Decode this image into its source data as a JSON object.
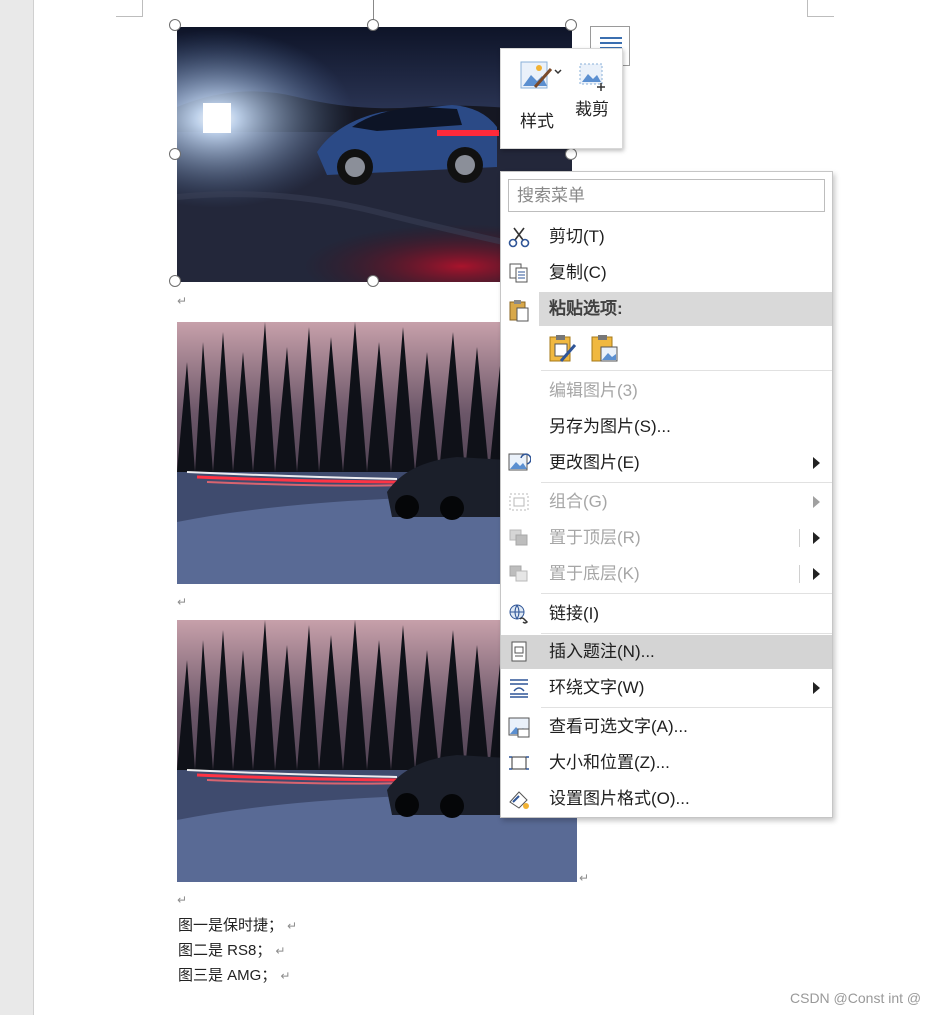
{
  "document": {
    "captions": [
      "图一是保时捷；",
      "图二是 RS8；",
      "图三是 AMG；"
    ],
    "paragraph_mark": "↵"
  },
  "mini_toolbar": {
    "style_label": "样式",
    "crop_label": "裁剪"
  },
  "context_menu": {
    "search_placeholder": "搜索菜单",
    "items": [
      {
        "label": "剪切(T)",
        "icon": "scissors-icon"
      },
      {
        "label": "复制(C)",
        "icon": "copy-icon"
      },
      {
        "label": "粘贴选项:",
        "icon": "paste-icon"
      },
      {
        "label": "编辑图片(3)",
        "icon": ""
      },
      {
        "label": "另存为图片(S)...",
        "icon": ""
      },
      {
        "label": "更改图片(E)",
        "icon": "change-picture-icon"
      },
      {
        "label": "组合(G)",
        "icon": "group-icon"
      },
      {
        "label": "置于顶层(R)",
        "icon": "bring-to-front-icon"
      },
      {
        "label": "置于底层(K)",
        "icon": "send-to-back-icon"
      },
      {
        "label": "链接(I)",
        "icon": "link-icon"
      },
      {
        "label": "插入题注(N)...",
        "icon": "insert-caption-icon"
      },
      {
        "label": "环绕文字(W)",
        "icon": "wrap-text-icon"
      },
      {
        "label": "查看可选文字(A)...",
        "icon": "alt-text-icon"
      },
      {
        "label": "大小和位置(Z)...",
        "icon": "size-position-icon"
      },
      {
        "label": "设置图片格式(O)...",
        "icon": "format-picture-icon"
      }
    ]
  },
  "watermark": "CSDN @Const int @",
  "colors": {
    "menu_hover": "#d4d4d4",
    "disabled_text": "#a6a6a6",
    "tail_light_red": "#ff2a3a"
  }
}
